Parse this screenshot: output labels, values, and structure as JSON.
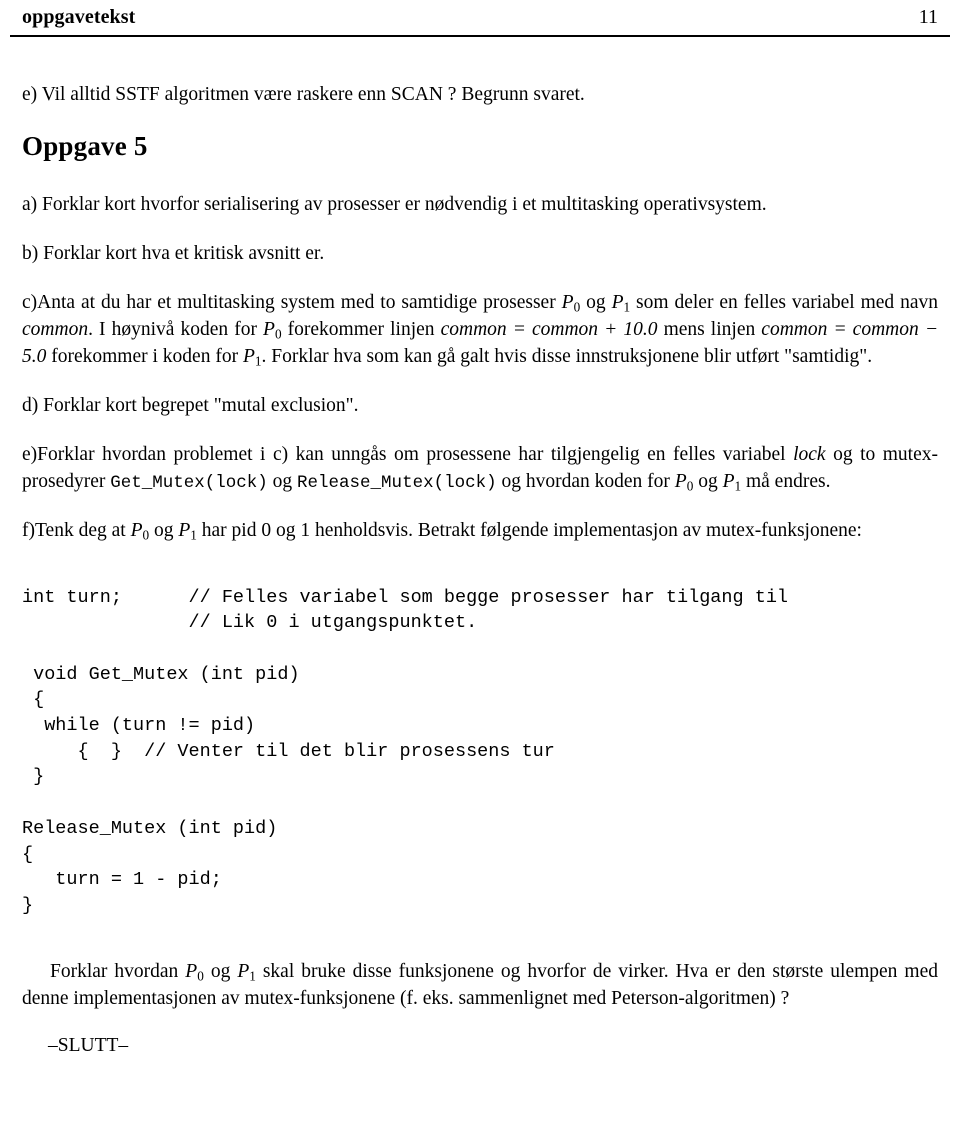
{
  "document": {
    "header": {
      "title": "oppgavetekst",
      "page_number": "11"
    },
    "items": {
      "e_prev": {
        "label": "e)",
        "text": "Vil alltid SSTF algoritmen være raskere enn SCAN ? Begrunn svaret."
      },
      "section_title": "Oppgave 5",
      "a": {
        "label": "a)",
        "text": "Forklar kort hvorfor serialisering av prosesser er nødvendig i et multitasking operativsystem."
      },
      "b": {
        "label": "b)",
        "text": "Forklar kort hva et kritisk avsnitt er."
      },
      "c": {
        "label": "c)",
        "t1": "Anta at du har et multitasking system med to samtidige prosesser ",
        "p0": "P",
        "p0_sub": "0",
        "t2": " og ",
        "p1": "P",
        "p1_sub": "1",
        "t3": " som deler en felles variabel med navn ",
        "common1": "common",
        "t4": ". I høynivå koden for ",
        "p0b": "P",
        "p0b_sub": "0",
        "t5": " forekommer linjen ",
        "eq1": "common = common + 10.0",
        "t6": " mens linjen ",
        "eq2": "common = common − 5.0",
        "t7": " forekommer i koden for ",
        "p1b": "P",
        "p1b_sub": "1",
        "t8": ". Forklar hva som kan gå galt hvis disse innstruksjonene blir utført \"samtidig\"."
      },
      "d": {
        "label": "d)",
        "text": "Forklar kort begrepet \"mutal exclusion\"."
      },
      "e": {
        "label": "e)",
        "t1": "Forklar hvordan problemet i c) kan unngås om prosessene har tilgjengelig en felles variabel ",
        "lock": "lock",
        "t2": " og to mutex-prosedyrer ",
        "code1": "Get_Mutex(lock)",
        "t3": " og ",
        "code2": "Release_Mutex(lock)",
        "t4": " og hvordan koden for ",
        "p0": "P",
        "p0_sub": "0",
        "t5": " og ",
        "p1": "P",
        "p1_sub": "1",
        "t6": " må endres."
      },
      "f": {
        "label": "f)",
        "t1": "Tenk deg at ",
        "p0": "P",
        "p0_sub": "0",
        "t2": " og ",
        "p1": "P",
        "p1_sub": "1",
        "t3": " har pid 0 og 1 henholdsvis.  Betrakt følgende implementasjon av mutex-funksjonene:"
      },
      "closing": {
        "t1": "Forklar hvordan ",
        "p0": "P",
        "p0_sub": "0",
        "t2": " og ",
        "p1": "P",
        "p1_sub": "1",
        "t3": " skal bruke disse funksjonene og hvorfor de virker.  Hva er den største ulempen med denne implementasjonen av mutex-funksjonene (f.  eks.  sammenlignet med Peterson-algoritmen) ?"
      },
      "end_marker": "–SLUTT–"
    },
    "code_listing": "int turn;      // Felles variabel som begge prosesser har tilgang til\n               // Lik 0 i utgangspunktet.\n\n void Get_Mutex (int pid)\n {\n  while (turn != pid)\n     {  }  // Venter til det blir prosessens tur\n }\n\nRelease_Mutex (int pid)\n{\n   turn = 1 - pid;\n}"
  }
}
